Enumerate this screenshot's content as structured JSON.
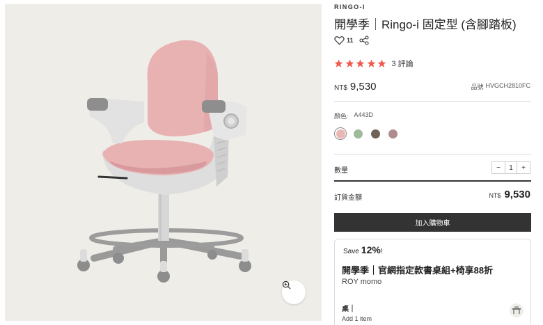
{
  "product": {
    "brand": "RINGO-I",
    "title": "開學季｜Ringo-i 固定型 (含腳踏板)",
    "like_count": "11",
    "rating": 5,
    "review_count": "3 評論",
    "price_currency": "NT$",
    "price": "9,530",
    "sku_label": "品號",
    "sku": "HVGCH2810FC"
  },
  "color": {
    "label": "顏色:",
    "selected": "A443D",
    "swatches": [
      "#e9b8b6",
      "#9fb99d",
      "#6f6258",
      "#ae8c8c"
    ]
  },
  "quantity": {
    "label": "數量",
    "minus": "−",
    "value": "1",
    "plus": "+"
  },
  "total": {
    "label": "訂貨金額",
    "currency": "NT$",
    "amount": "9,530"
  },
  "cart_button": "加入購物車",
  "promo": {
    "save_prefix": "Save",
    "save_percent": "12%",
    "save_suffix": "!",
    "title": "開學季｜官網指定款書桌組+椅享88折",
    "store": "ROY momo",
    "item": "桌｜",
    "add": "Add 1 item"
  },
  "icons": {
    "zoom": "zoom-in-icon",
    "heart": "heart-icon",
    "share": "share-icon",
    "star": "star-icon"
  },
  "colors": {
    "accent_star": "#ef5b4f",
    "button_bg": "#333333",
    "gallery_bg": "#efede8"
  }
}
